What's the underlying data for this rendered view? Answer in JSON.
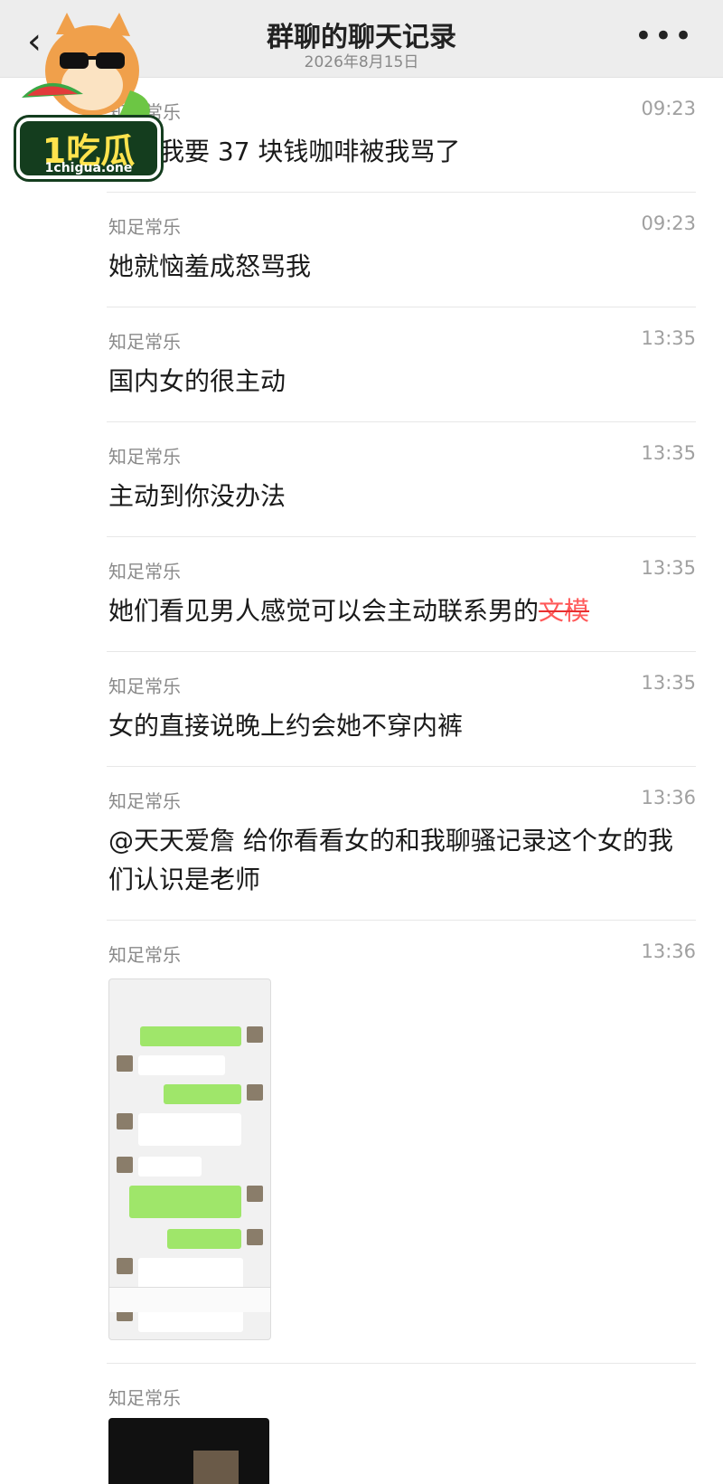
{
  "header": {
    "title": "群聊的聊天记录",
    "date": "2026年8月15日",
    "back_icon": "chevron-left-icon",
    "more_icon": "more-dots-icon"
  },
  "watermark": {
    "main": "1吃瓜",
    "url": "1chigua.one"
  },
  "messages": [
    {
      "sender": "知足常乐",
      "time": "09:23",
      "text": "问我要 37 块钱咖啡被我骂了"
    },
    {
      "sender": "知足常乐",
      "time": "09:23",
      "text": "她就恼羞成怒骂我"
    },
    {
      "sender": "知足常乐",
      "time": "13:35",
      "text": "国内女的很主动"
    },
    {
      "sender": "知足常乐",
      "time": "13:35",
      "text": "主动到你没办法"
    },
    {
      "sender": "知足常乐",
      "time": "13:35",
      "text": "她们看见男人感觉可以会主动联系男的",
      "struck": "文模"
    },
    {
      "sender": "知足常乐",
      "time": "13:35",
      "text": "女的直接说晚上约会她不穿内裤"
    },
    {
      "sender": "知足常乐",
      "time": "13:36",
      "text": "@天天爱詹 给你看看女的和我聊骚记录这个女的我们认识是老师"
    },
    {
      "sender": "知足常乐",
      "time": "13:36",
      "image": "chat-screenshot-image"
    },
    {
      "sender": "知足常乐",
      "image": "chat-screenshot-image-2"
    }
  ]
}
